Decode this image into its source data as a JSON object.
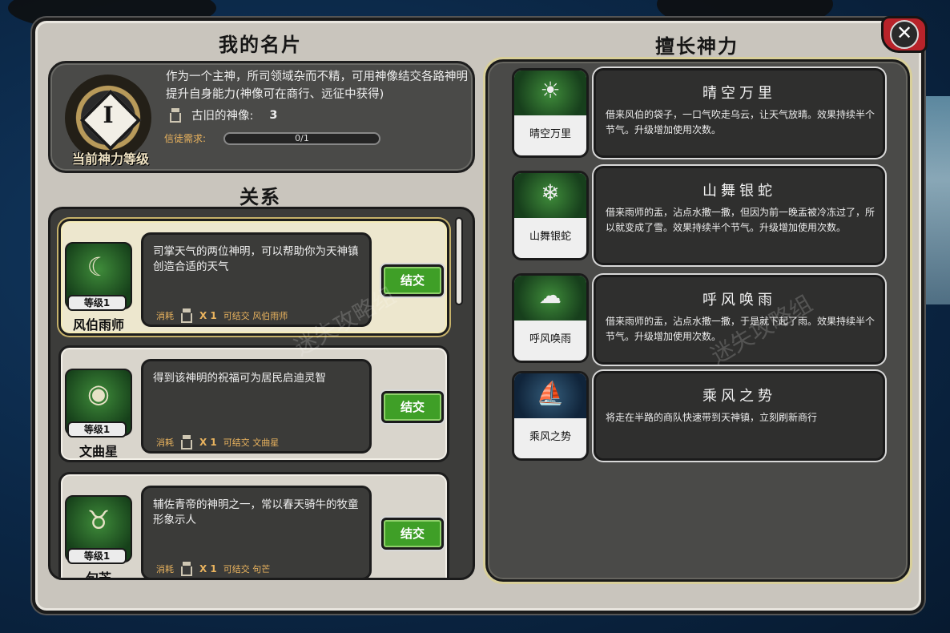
{
  "header": {
    "card_title": "我的名片",
    "powers_title": "擅长神力",
    "relations_title": "关系"
  },
  "close_button": {
    "glyph": "✕"
  },
  "card": {
    "emblem_numeral": "I",
    "emblem_label": "当前神力等级",
    "description": "作为一个主神，所司领域杂而不精，可用神像结交各路神明提升自身能力(神像可在商行、远征中获得)",
    "statue_label": "古旧的神像:",
    "statue_count": "3",
    "requirement_label": "信徒需求:",
    "requirement_progress": "0/1"
  },
  "relations": [
    {
      "name": "风伯雨师",
      "level": "等级1",
      "description": "司掌天气的两位神明，可以帮助你为天神镇创造合适的天气",
      "cost_label": "消耗",
      "cost_mult": "X 1",
      "cost_text": "可结交 风伯雨师",
      "button": "结交",
      "icon": "crescent-sun-icon",
      "glyph": "☾"
    },
    {
      "name": "文曲星",
      "level": "等级1",
      "description": "得到该神明的祝福可为居民启迪灵智",
      "cost_label": "消耗",
      "cost_mult": "X 1",
      "cost_text": "可结交 文曲星",
      "button": "结交",
      "icon": "eye-icon",
      "glyph": "◉"
    },
    {
      "name": "句芒",
      "level": "等级1",
      "description": "辅佐青帝的神明之一，常以春天骑牛的牧童形象示人",
      "cost_label": "消耗",
      "cost_mult": "X 1",
      "cost_text": "可结交 句芒",
      "button": "结交",
      "icon": "ox-icon",
      "glyph": "♉"
    }
  ],
  "powers": [
    {
      "card_name": "晴空万里",
      "title": "晴空万里",
      "description": "借来风伯的袋子，一口气吹走乌云，让天气放晴。效果持续半个节气。升级增加使用次数。",
      "icon": "sun-icon",
      "glyph": "☀",
      "art": "green"
    },
    {
      "card_name": "山舞银蛇",
      "title": "山舞银蛇",
      "description": "借来雨师的盂，沾点水撒一撒，但因为前一晚盂被冷冻过了，所以就变成了雪。效果持续半个节气。升级增加使用次数。",
      "icon": "snowflake-icon",
      "glyph": "❄",
      "art": "green"
    },
    {
      "card_name": "呼风唤雨",
      "title": "呼风唤雨",
      "description": "借来雨师的盂，沾点水撒一撒，于是就下起了雨。效果持续半个节气。升级增加使用次数。",
      "icon": "rain-cloud-icon",
      "glyph": "☁",
      "art": "green"
    },
    {
      "card_name": "乘风之势",
      "title": "乘风之势",
      "description": "将走在半路的商队快速带到天神镇，立刻刷新商行",
      "icon": "sailboat-icon",
      "glyph": "⛵",
      "art": "blue"
    }
  ],
  "watermark": "迷失攻略组"
}
